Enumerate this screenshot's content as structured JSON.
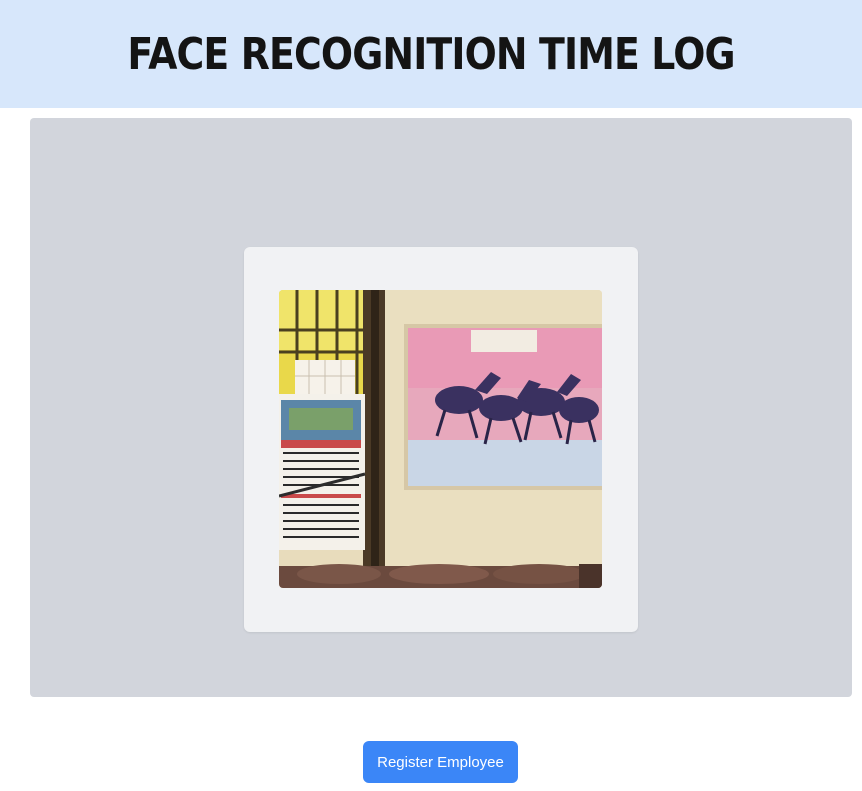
{
  "header": {
    "title": "FACE RECOGNITION TIME LOG"
  },
  "camera": {
    "icon": "webcam-feed"
  },
  "actions": {
    "register_label": "Register Employee"
  },
  "colors": {
    "header_bg": "#d7e7fb",
    "stage_bg": "#d2d5dc",
    "card_bg": "#f1f2f4",
    "button_bg": "#3b86f7"
  }
}
